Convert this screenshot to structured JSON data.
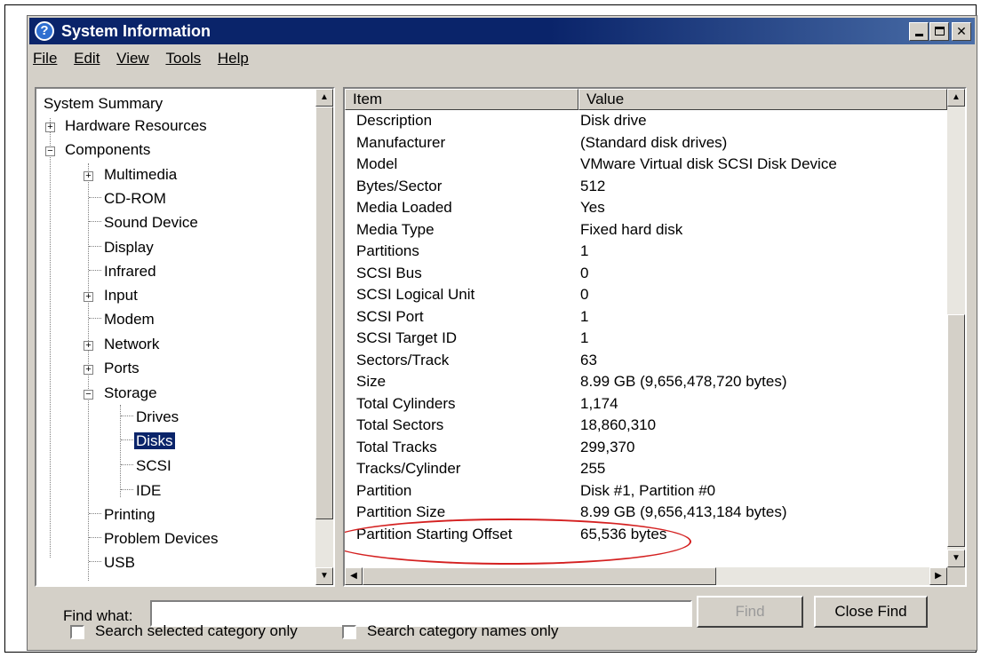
{
  "window": {
    "title": "System Information",
    "icon": "help-question-icon"
  },
  "menu": [
    "File",
    "Edit",
    "View",
    "Tools",
    "Help"
  ],
  "tree": {
    "root": "System Summary",
    "hardware_resources": "Hardware Resources",
    "components": "Components",
    "children": [
      "Multimedia",
      "CD-ROM",
      "Sound Device",
      "Display",
      "Infrared",
      "Input",
      "Modem",
      "Network",
      "Ports",
      "Storage"
    ],
    "storage_children": [
      "Drives",
      "Disks",
      "SCSI",
      "IDE"
    ],
    "tail": [
      "Printing",
      "Problem Devices",
      "USB"
    ],
    "selected": "Disks"
  },
  "list": {
    "columns": [
      "Item",
      "Value"
    ],
    "rows": [
      {
        "item": "Description",
        "value": "Disk drive"
      },
      {
        "item": "Manufacturer",
        "value": "(Standard disk drives)"
      },
      {
        "item": "Model",
        "value": "VMware Virtual disk SCSI Disk Device"
      },
      {
        "item": "Bytes/Sector",
        "value": "512"
      },
      {
        "item": "Media Loaded",
        "value": "Yes"
      },
      {
        "item": "Media Type",
        "value": "Fixed hard disk"
      },
      {
        "item": "Partitions",
        "value": "1"
      },
      {
        "item": "SCSI Bus",
        "value": "0"
      },
      {
        "item": "SCSI Logical Unit",
        "value": "0"
      },
      {
        "item": "SCSI Port",
        "value": "1"
      },
      {
        "item": "SCSI Target ID",
        "value": "1"
      },
      {
        "item": "Sectors/Track",
        "value": "63"
      },
      {
        "item": "Size",
        "value": "8.99 GB (9,656,478,720 bytes)"
      },
      {
        "item": "Total Cylinders",
        "value": "1,174"
      },
      {
        "item": "Total Sectors",
        "value": "18,860,310"
      },
      {
        "item": "Total Tracks",
        "value": "299,370"
      },
      {
        "item": "Tracks/Cylinder",
        "value": "255"
      },
      {
        "item": "Partition",
        "value": "Disk #1, Partition #0"
      },
      {
        "item": "Partition Size",
        "value": "8.99 GB (9,656,413,184 bytes)"
      },
      {
        "item": "Partition Starting Offset",
        "value": "65,536 bytes"
      }
    ]
  },
  "find": {
    "label": "Find what:",
    "value": "",
    "find_button": "Find",
    "close_button": "Close Find",
    "option1": "Search selected category only",
    "option2": "Search category names only"
  },
  "colors": {
    "title_bar": "#0a246a",
    "highlight_oval": "#d42020",
    "window_face": "#d4d0c8"
  }
}
